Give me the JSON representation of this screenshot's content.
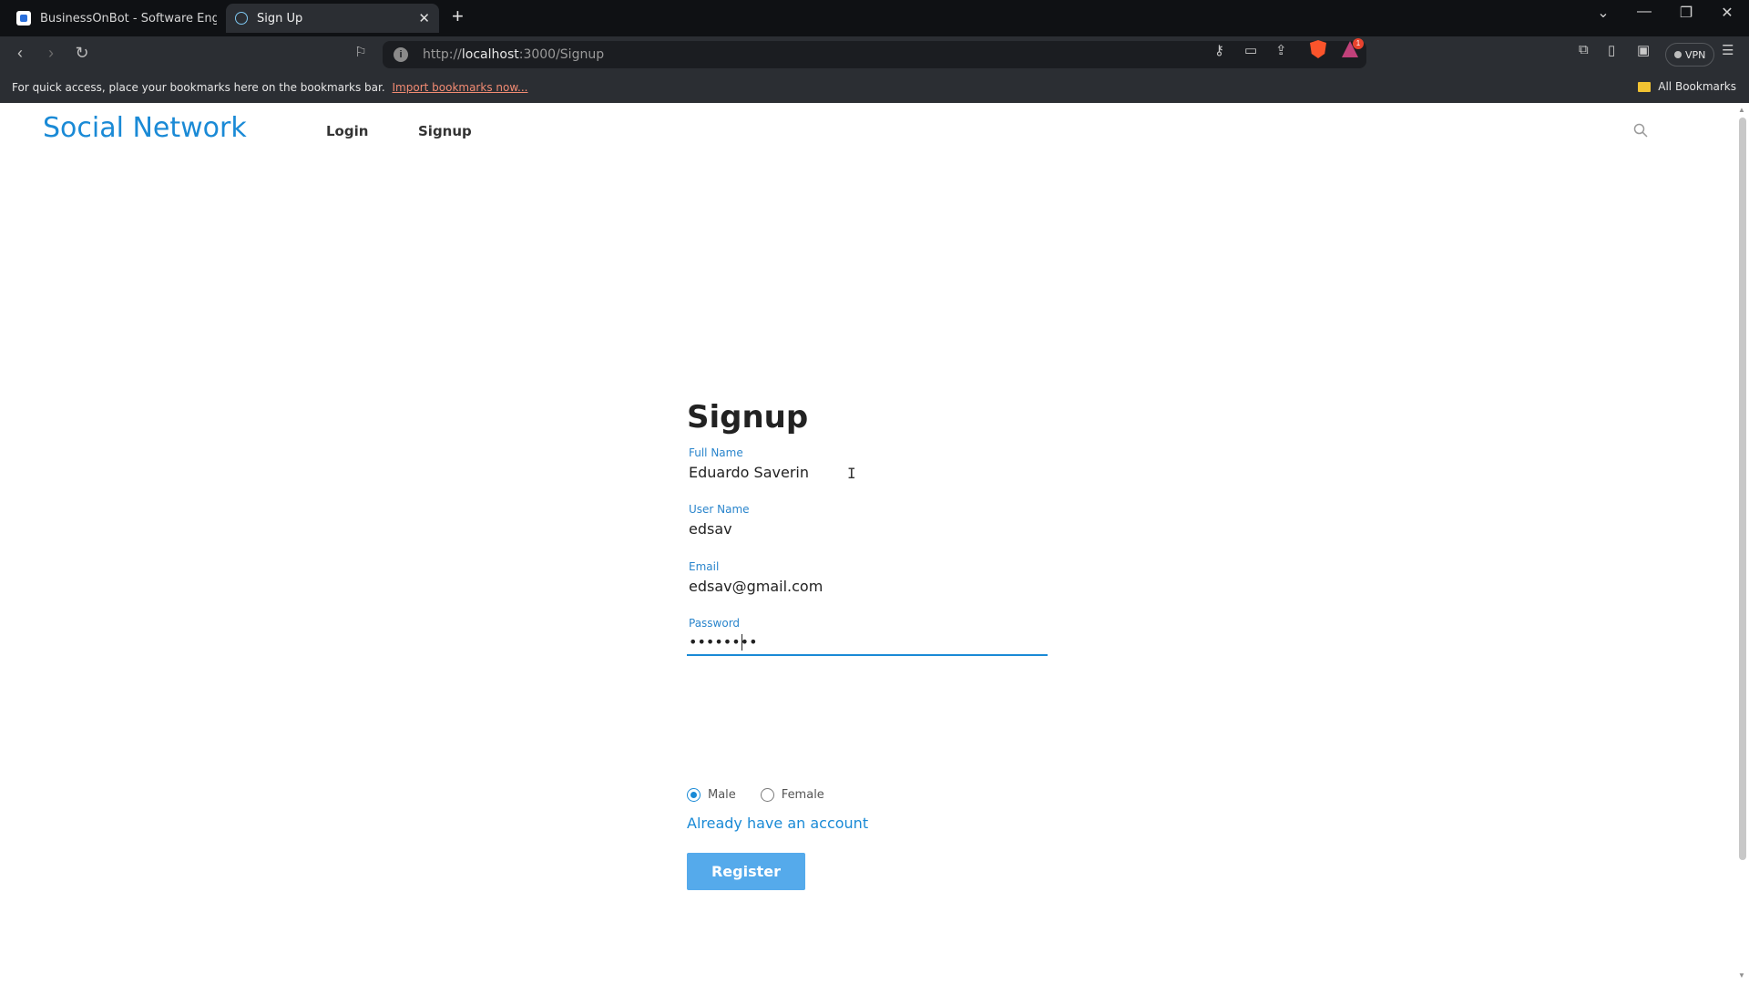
{
  "browser": {
    "tabs": [
      {
        "title": "BusinessOnBot - Software Engineeri",
        "active": false
      },
      {
        "title": "Sign Up",
        "active": true
      }
    ],
    "url_prefix": "http://",
    "url_host": "localhost",
    "url_path": ":3000/Signup",
    "vpn_label": "VPN",
    "rewards_badge": "1",
    "bookmarks_bar": {
      "message": "For quick access, place your bookmarks here on the bookmarks bar.",
      "import_link": "Import bookmarks now...",
      "all_bookmarks": "All Bookmarks"
    }
  },
  "site": {
    "brand": "Social Network",
    "nav": [
      {
        "label": "Login"
      },
      {
        "label": "Signup"
      }
    ]
  },
  "form": {
    "title": "Signup",
    "fields": [
      {
        "label": "Full Name",
        "value": "Eduardo Saverin",
        "type": "text"
      },
      {
        "label": "User Name",
        "value": "edsav",
        "type": "text"
      },
      {
        "label": "Email",
        "value": "edsav@gmail.com",
        "type": "text"
      },
      {
        "label": "Password",
        "value": "••••••••",
        "type": "password"
      }
    ],
    "gender": {
      "options": [
        "Male",
        "Female"
      ],
      "selected": "Male"
    },
    "login_link": "Already have an account",
    "submit_label": "Register"
  },
  "colors": {
    "accent": "#1a8ad6",
    "button": "#55aaeb"
  }
}
